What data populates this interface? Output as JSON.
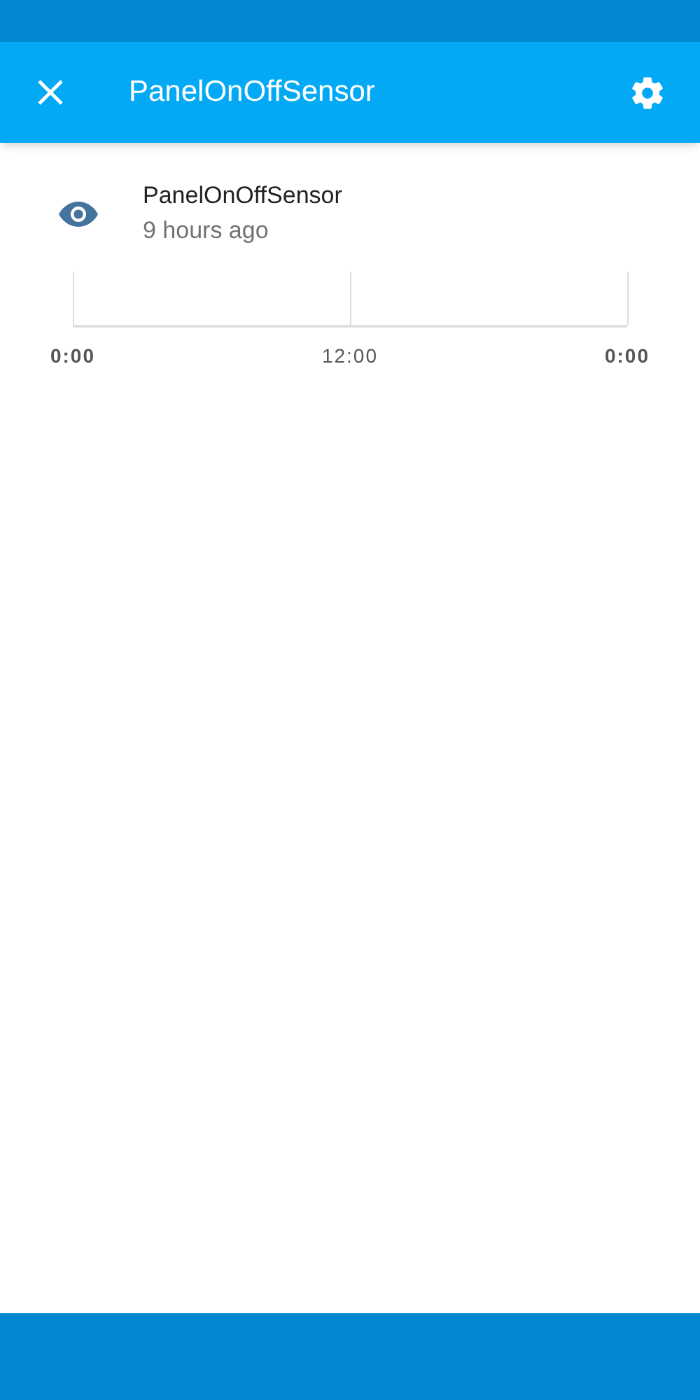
{
  "header": {
    "title": "PanelOnOffSensor"
  },
  "entity": {
    "name": "PanelOnOffSensor",
    "last_changed": "9 hours ago"
  },
  "timeline": {
    "ticks": [
      {
        "label": "0:00",
        "bold": true
      },
      {
        "label": "12:00",
        "bold": false
      },
      {
        "label": "0:00",
        "bold": true
      }
    ]
  }
}
